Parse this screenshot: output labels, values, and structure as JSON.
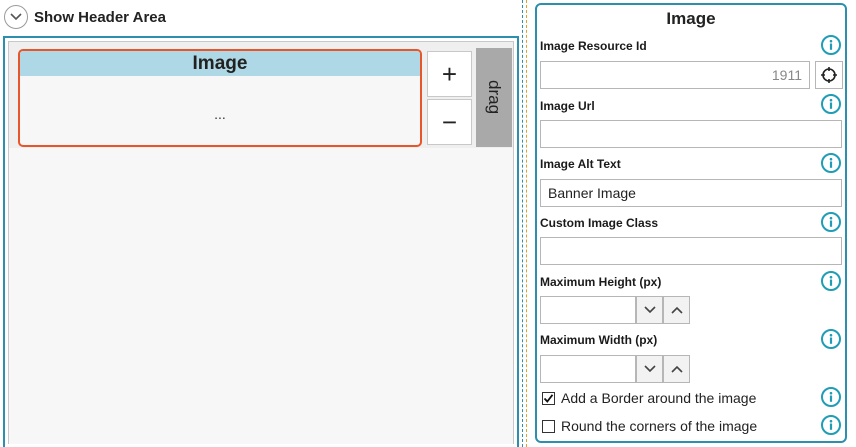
{
  "header": {
    "toggle_label": "Show Header Area"
  },
  "canvas": {
    "widget": {
      "title": "Image",
      "body": "..."
    },
    "add_label": "+",
    "remove_label": "−",
    "drag_label": "drag"
  },
  "panel": {
    "title": "Image",
    "resource_id": {
      "label": "Image Resource Id",
      "value": "1911"
    },
    "url": {
      "label": "Image Url",
      "value": ""
    },
    "alt_text": {
      "label": "Image Alt Text",
      "value": "Banner Image"
    },
    "custom_class": {
      "label": "Custom Image Class",
      "value": ""
    },
    "max_height": {
      "label": "Maximum Height (px)",
      "value": ""
    },
    "max_width": {
      "label": "Maximum Width (px)",
      "value": ""
    },
    "border_checkbox": {
      "label": "Add a Border around the image",
      "checked": true
    },
    "round_checkbox": {
      "label": "Round the corners of the image",
      "checked": false
    }
  },
  "colors": {
    "accent": "#2d8fae",
    "info": "#1f9db5",
    "selection": "#e8552b",
    "widget_header": "#aed8e5"
  },
  "icons": [
    "chevron-down-icon",
    "info-icon",
    "crosshair-icon",
    "chevron-up-icon",
    "checkmark-icon"
  ]
}
